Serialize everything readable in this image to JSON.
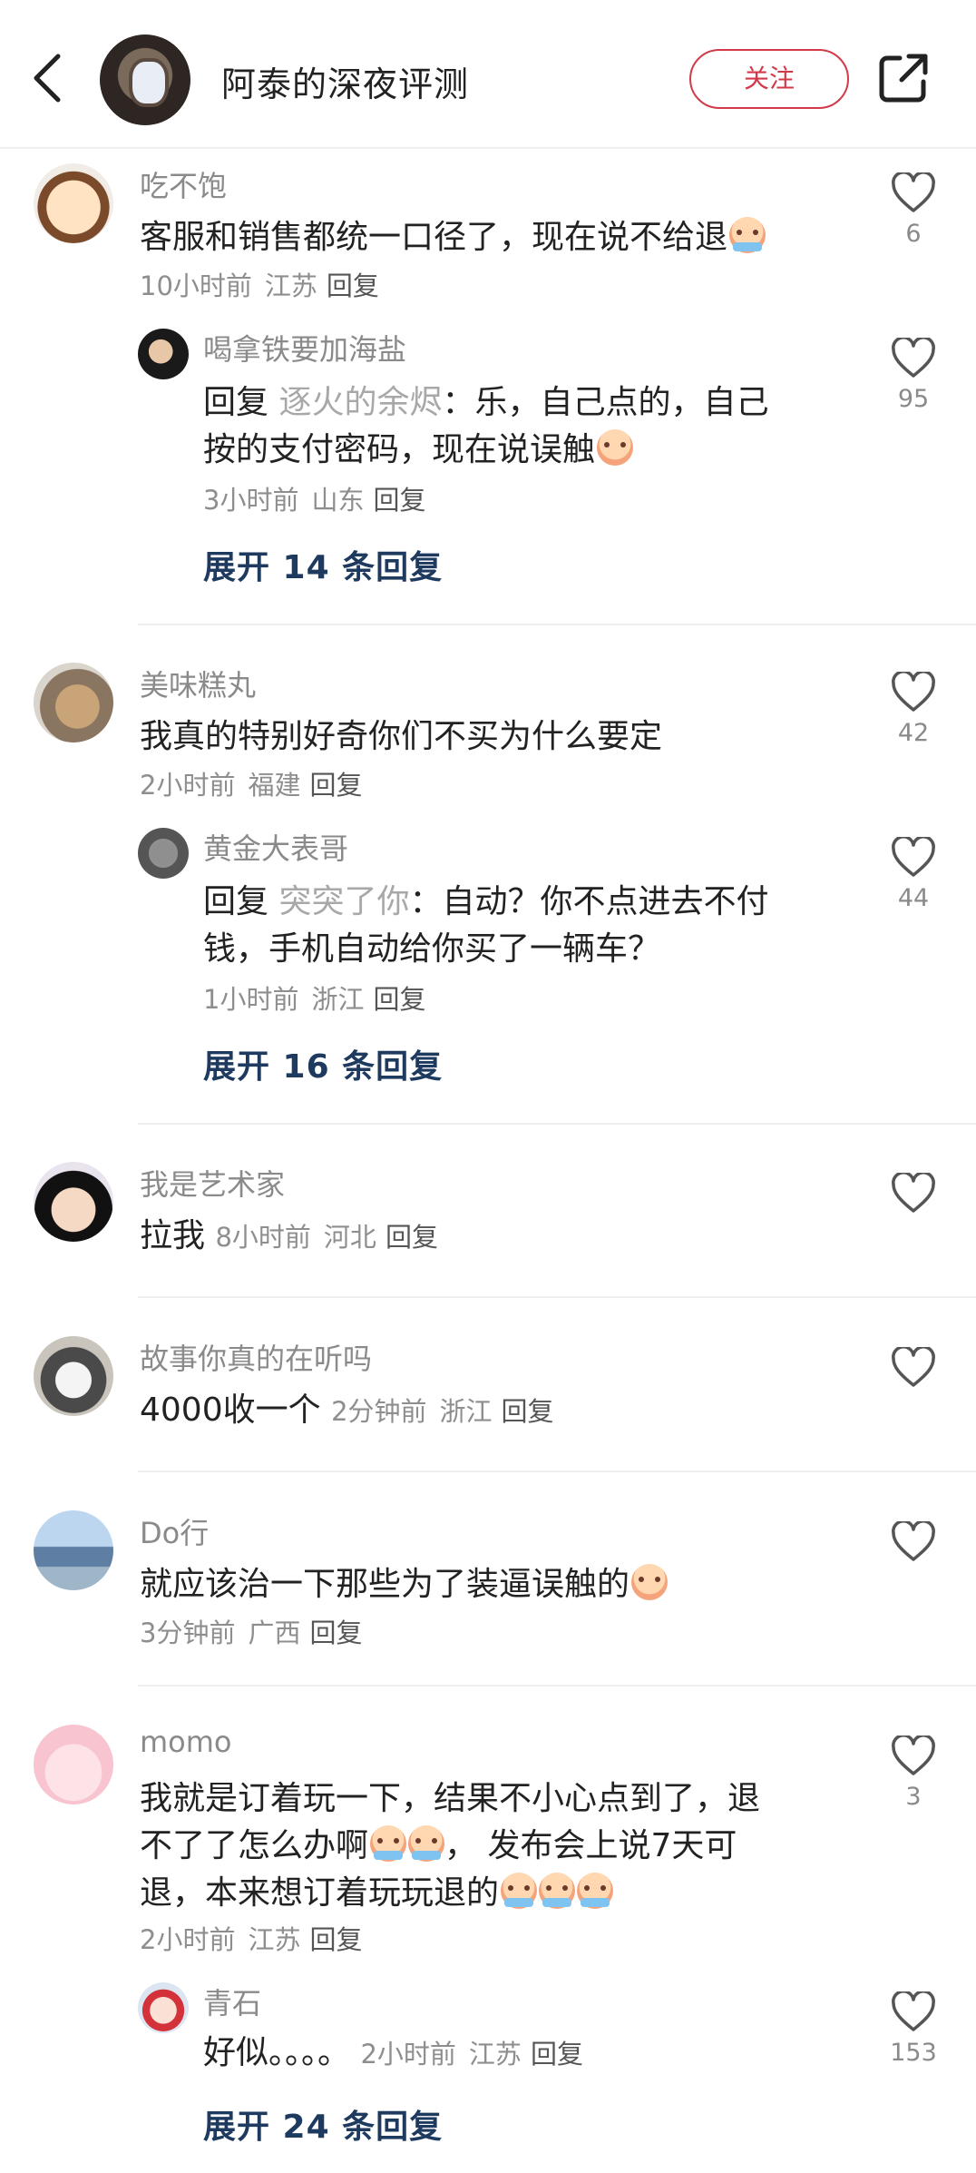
{
  "header": {
    "title": "阿泰的深夜评测",
    "follow_label": "关注",
    "accent": "#d23a4a"
  },
  "comments": [
    {
      "user": "吃不饱",
      "text": "客服和销售都统一口径了，现在说不给退",
      "time": "10小时前",
      "location": "江苏",
      "reply_label": "回复",
      "likes": "6",
      "sub": {
        "user": "喝拿铁要加海盐",
        "prefix": "回复",
        "reply_to": "逐火的余烬",
        "text_line1": "：乐，自己点的，自己",
        "text_line2": "按的支付密码，现在说误触",
        "time": "3小时前",
        "location": "山东",
        "reply_label": "回复",
        "likes": "95"
      },
      "expand": "展开 14 条回复"
    },
    {
      "user": "美味糕丸",
      "text": "我真的特别好奇你们不买为什么要定",
      "time": "2小时前",
      "location": "福建",
      "reply_label": "回复",
      "likes": "42",
      "sub": {
        "user": "黄金大表哥",
        "prefix": "回复",
        "reply_to": "突突了你",
        "text_line1": "：自动？你不点进去不付",
        "text_line2": "钱，手机自动给你买了一辆车？",
        "time": "1小时前",
        "location": "浙江",
        "reply_label": "回复",
        "likes": "44"
      },
      "expand": "展开 16 条回复"
    },
    {
      "user": "我是艺术家",
      "text": "拉我",
      "time": "8小时前",
      "location": "河北",
      "reply_label": "回复"
    },
    {
      "user": "故事你真的在听吗",
      "text": "4000收一个",
      "time": "2分钟前",
      "location": "浙江",
      "reply_label": "回复"
    },
    {
      "user": "Do行",
      "text": "就应该治一下那些为了装逼误触的",
      "time": "3分钟前",
      "location": "广西",
      "reply_label": "回复"
    },
    {
      "user": "momo",
      "text_line1": "我就是订着玩一下，结果不小心点到了，退",
      "text_line2": "不了了怎么办啊",
      "text_line2b": "， 发布会上说7天可",
      "text_line3": "退，本来想订着玩玩退的",
      "time": "2小时前",
      "location": "江苏",
      "reply_label": "回复",
      "likes": "3",
      "sub": {
        "user": "青石",
        "text": "好似。。。。",
        "time": "2小时前",
        "location": "江苏",
        "reply_label": "回复",
        "likes": "153"
      },
      "expand": "展开 24 条回复"
    }
  ]
}
